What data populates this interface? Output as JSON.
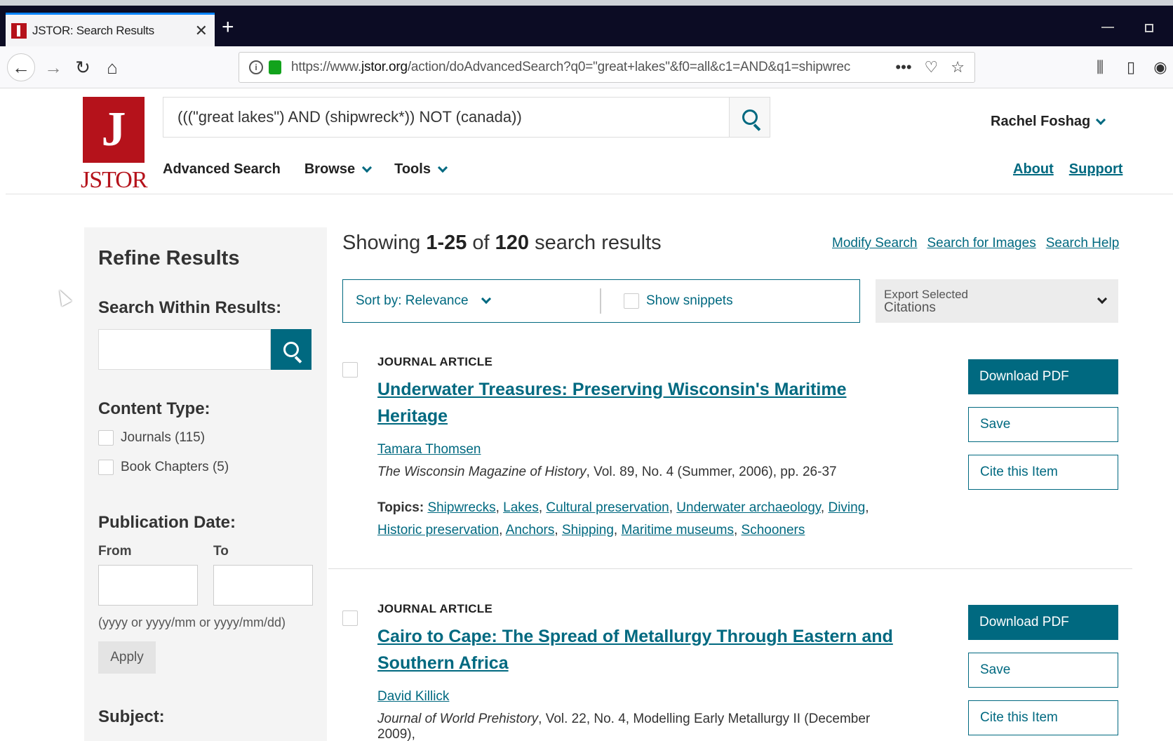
{
  "browser": {
    "tab_title": "JSTOR: Search Results",
    "tab_close": "✕",
    "new_tab": "+",
    "url_prefix": "https://www.",
    "url_domain": "jstor.org",
    "url_rest": "/action/doAdvancedSearch?q0=\"great+lakes\"&f0=all&c1=AND&q1=shipwrec",
    "icons": [
      "back-icon",
      "forward-icon",
      "reload-icon",
      "home-icon",
      "info-icon",
      "lock-icon",
      "more-icon",
      "pocket-icon",
      "star-icon",
      "library-icon",
      "sidebar-icon",
      "account-icon"
    ]
  },
  "header": {
    "logo_text": "JSTOR",
    "search_value": "(((\"great lakes\") AND (shipwreck*)) NOT (canada))",
    "user_name": "Rachel Foshag",
    "nav": {
      "advanced": "Advanced Search",
      "browse": "Browse",
      "tools": "Tools"
    },
    "about": "About",
    "support": "Support"
  },
  "sidebar": {
    "title": "Refine Results",
    "within_label": "Search Within Results:",
    "content_type_label": "Content Type:",
    "content_types": [
      {
        "label": "Journals (115)"
      },
      {
        "label": "Book Chapters (5)"
      }
    ],
    "pub_date_label": "Publication Date:",
    "from_label": "From",
    "to_label": "To",
    "date_hint": "(yyyy or yyyy/mm or yyyy/mm/dd)",
    "apply": "Apply",
    "subject_label": "Subject:"
  },
  "results": {
    "showing_prefix": "Showing ",
    "range": "1-25",
    "of": " of ",
    "total": "120",
    "suffix": " search results",
    "modify": "Modify Search",
    "images": "Search for Images",
    "help": "Search Help",
    "sort_label": "Sort by: Relevance",
    "snippets": "Show snippets",
    "export_line1": "Export Selected",
    "export_line2": "Citations",
    "buttons": {
      "pdf": "Download PDF",
      "save": "Save",
      "cite": "Cite this Item"
    },
    "topics_label": "Topics:",
    "items": [
      {
        "type": "JOURNAL ARTICLE",
        "title": "Underwater Treasures: Preserving Wisconsin's Maritime Heritage",
        "author": "Tamara Thomsen",
        "journal": "The Wisconsin Magazine of History",
        "details": ", Vol. 89, No. 4 (Summer, 2006), pp. 26-37",
        "topics": [
          "Shipwrecks",
          "Lakes",
          "Cultural preservation",
          "Underwater archaeology",
          "Diving",
          "Historic preservation",
          "Anchors",
          "Shipping",
          "Maritime museums",
          "Schooners"
        ]
      },
      {
        "type": "JOURNAL ARTICLE",
        "title": "Cairo to Cape: The Spread of Metallurgy Through Eastern and Southern Africa",
        "author": "David Killick",
        "journal": "Journal of World Prehistory",
        "details": ", Vol. 22, No. 4, Modelling Early Metallurgy II (December 2009),"
      }
    ]
  }
}
